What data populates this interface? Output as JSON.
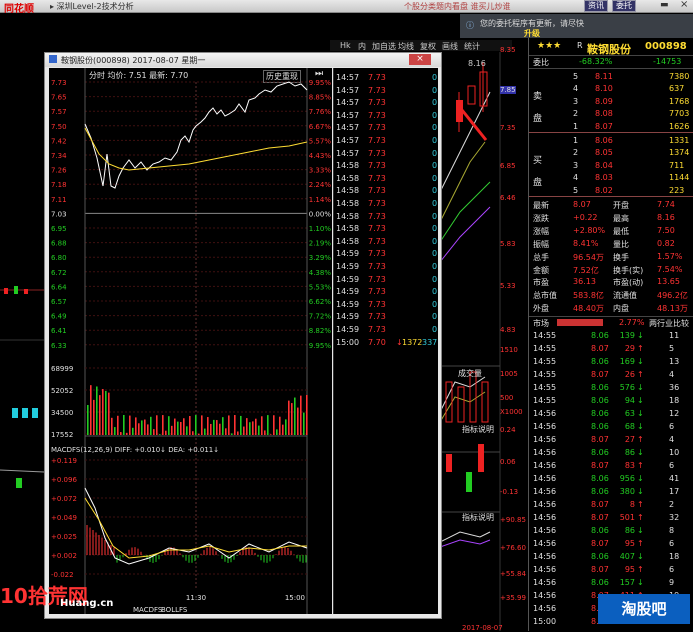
{
  "topbar": {
    "logo": "同花顺",
    "menu": "▸ 深圳Level-2技术分析",
    "ads": "个股分类题内看盘   谁买儿炒谁",
    "btn1": "资讯",
    "btn2": "委托"
  },
  "notify": {
    "line1": "您的委托程序有更新，请尽快",
    "line2": "升级"
  },
  "toolbar": {
    "items": [
      "Hk",
      "内",
      "加自选",
      "均线",
      "复权",
      "画线",
      "统计"
    ]
  },
  "stock": {
    "name": "鞍钢股份",
    "code": "000898",
    "stars": "★★★",
    "r": "R",
    "weibi_label": "委比",
    "weibi": "-68.32%",
    "weicha": "-14753",
    "sell_label": "卖盘",
    "buy_label": "买盘",
    "asks": [
      {
        "lvl": "5",
        "price": "8.11",
        "vol": "7380"
      },
      {
        "lvl": "4",
        "price": "8.10",
        "vol": "637"
      },
      {
        "lvl": "3",
        "price": "8.09",
        "vol": "1768"
      },
      {
        "lvl": "2",
        "price": "8.08",
        "vol": "7703"
      },
      {
        "lvl": "1",
        "price": "8.07",
        "vol": "1626"
      }
    ],
    "bids": [
      {
        "lvl": "1",
        "price": "8.06",
        "vol": "1331"
      },
      {
        "lvl": "2",
        "price": "8.05",
        "vol": "1374"
      },
      {
        "lvl": "3",
        "price": "8.04",
        "vol": "711"
      },
      {
        "lvl": "4",
        "price": "8.03",
        "vol": "1144"
      },
      {
        "lvl": "5",
        "price": "8.02",
        "vol": "223"
      }
    ],
    "stats": [
      {
        "l1": "最新",
        "v1": "8.07",
        "l2": "开盘",
        "v2": "7.74"
      },
      {
        "l1": "涨跌",
        "v1": "+0.22",
        "l2": "最高",
        "v2": "8.16"
      },
      {
        "l1": "涨幅",
        "v1": "+2.80%",
        "l2": "最低",
        "v2": "7.50"
      },
      {
        "l1": "振幅",
        "v1": "8.41%",
        "l2": "量比",
        "v2": "0.82"
      },
      {
        "l1": "总手",
        "v1": "96.54万",
        "l2": "换手",
        "v2": "1.57%"
      },
      {
        "l1": "金额",
        "v1": "7.52亿",
        "l2": "换手(实)",
        "v2": "7.54%"
      },
      {
        "l1": "市盈",
        "v1": "36.13",
        "l2": "市盈(动)",
        "v2": "13.65"
      },
      {
        "l1": "总市值",
        "v1": "583.8亿",
        "l2": "流通值",
        "v2": "496.2亿"
      },
      {
        "l1": "外盘",
        "v1": "48.40万",
        "l2": "内盘",
        "v2": "48.13万"
      }
    ],
    "bar_label": "市场",
    "bar_pct": "2.77%",
    "bar_right": "两行业比较",
    "trades": [
      {
        "t": "14:55",
        "p": "8.06",
        "v": "139",
        "d": "dn",
        "n": "11"
      },
      {
        "t": "14:55",
        "p": "8.07",
        "v": "29",
        "d": "up",
        "n": "5"
      },
      {
        "t": "14:55",
        "p": "8.06",
        "v": "169",
        "d": "dn",
        "n": "13"
      },
      {
        "t": "14:55",
        "p": "8.07",
        "v": "26",
        "d": "up",
        "n": "4"
      },
      {
        "t": "14:55",
        "p": "8.06",
        "v": "576",
        "d": "dn",
        "n": "36"
      },
      {
        "t": "14:55",
        "p": "8.06",
        "v": "94",
        "d": "dn",
        "n": "18"
      },
      {
        "t": "14:56",
        "p": "8.06",
        "v": "63",
        "d": "dn",
        "n": "12"
      },
      {
        "t": "14:56",
        "p": "8.06",
        "v": "68",
        "d": "dn",
        "n": "6"
      },
      {
        "t": "14:56",
        "p": "8.07",
        "v": "27",
        "d": "up",
        "n": "4"
      },
      {
        "t": "14:56",
        "p": "8.06",
        "v": "86",
        "d": "dn",
        "n": "10"
      },
      {
        "t": "14:56",
        "p": "8.07",
        "v": "83",
        "d": "up",
        "n": "6"
      },
      {
        "t": "14:56",
        "p": "8.06",
        "v": "956",
        "d": "dn",
        "n": "41"
      },
      {
        "t": "14:56",
        "p": "8.06",
        "v": "380",
        "d": "dn",
        "n": "17"
      },
      {
        "t": "14:56",
        "p": "8.07",
        "v": "8",
        "d": "up",
        "n": "2"
      },
      {
        "t": "14:56",
        "p": "8.07",
        "v": "501",
        "d": "up",
        "n": "32"
      },
      {
        "t": "14:56",
        "p": "8.06",
        "v": "86",
        "d": "dn",
        "n": "8"
      },
      {
        "t": "14:56",
        "p": "8.07",
        "v": "95",
        "d": "up",
        "n": "6"
      },
      {
        "t": "14:56",
        "p": "8.06",
        "v": "407",
        "d": "dn",
        "n": "18"
      },
      {
        "t": "14:56",
        "p": "8.07",
        "v": "95",
        "d": "up",
        "n": "6"
      },
      {
        "t": "14:56",
        "p": "8.06",
        "v": "157",
        "d": "dn",
        "n": "9"
      },
      {
        "t": "14:56",
        "p": "8.07",
        "v": "411",
        "d": "up",
        "n": "19"
      },
      {
        "t": "14:56",
        "p": "8.07",
        "v": "87",
        "d": "up",
        "n": "5"
      },
      {
        "t": "15:00",
        "p": "8.07",
        "v": "7769",
        "d": "up",
        "n": "9"
      }
    ]
  },
  "popup": {
    "title": "鞍钢股份(000898)  2017-08-07 星期一",
    "header": "分时  均价: 7.51  最新: 7.70",
    "history_btn": "历史重现",
    "price_labels": [
      "7.73",
      "7.65",
      "7.57",
      "7.50",
      "7.42",
      "7.34",
      "7.26",
      "7.18",
      "7.11",
      "7.03",
      "6.95",
      "6.88",
      "6.80",
      "6.72",
      "6.64",
      "6.57",
      "6.49",
      "6.41",
      "6.33"
    ],
    "pct_labels": [
      "9.95%",
      "8.85%",
      "7.76%",
      "6.67%",
      "5.57%",
      "4.43%",
      "3.33%",
      "2.24%",
      "1.14%",
      "0.00%",
      "1.10%",
      "2.19%",
      "3.29%",
      "4.38%",
      "5.53%",
      "6.62%",
      "7.72%",
      "8.82%",
      "9.95%"
    ],
    "vol_labels": [
      "68999",
      "52052",
      "34500",
      "17552"
    ],
    "macd_title": "MACDFS(12,26,9)  DIFF: +0.010↓  DEA: +0.011↓",
    "macd_labels": [
      "+0.119",
      "+0.096",
      "+0.072",
      "+0.049",
      "+0.025",
      "+0.002",
      "-0.022"
    ],
    "time_labels": [
      "11:30",
      "15:00"
    ],
    "tabs": [
      "MACDFS",
      "BOLLFS"
    ],
    "ticks": [
      {
        "t": "14:57",
        "p": "7.73",
        "v": "0"
      },
      {
        "t": "14:57",
        "p": "7.73",
        "v": "0"
      },
      {
        "t": "14:57",
        "p": "7.73",
        "v": "0"
      },
      {
        "t": "14:57",
        "p": "7.73",
        "v": "0"
      },
      {
        "t": "14:57",
        "p": "7.73",
        "v": "0"
      },
      {
        "t": "14:57",
        "p": "7.73",
        "v": "0"
      },
      {
        "t": "14:57",
        "p": "7.73",
        "v": "0"
      },
      {
        "t": "14:58",
        "p": "7.73",
        "v": "0"
      },
      {
        "t": "14:58",
        "p": "7.73",
        "v": "0"
      },
      {
        "t": "14:58",
        "p": "7.73",
        "v": "0"
      },
      {
        "t": "14:58",
        "p": "7.73",
        "v": "0"
      },
      {
        "t": "14:58",
        "p": "7.73",
        "v": "0"
      },
      {
        "t": "14:58",
        "p": "7.73",
        "v": "0"
      },
      {
        "t": "14:58",
        "p": "7.73",
        "v": "0"
      },
      {
        "t": "14:59",
        "p": "7.73",
        "v": "0"
      },
      {
        "t": "14:59",
        "p": "7.73",
        "v": "0"
      },
      {
        "t": "14:59",
        "p": "7.73",
        "v": "0"
      },
      {
        "t": "14:59",
        "p": "7.73",
        "v": "0"
      },
      {
        "t": "14:59",
        "p": "7.73",
        "v": "0"
      },
      {
        "t": "14:59",
        "p": "7.73",
        "v": "0"
      },
      {
        "t": "14:59",
        "p": "7.73",
        "v": "0"
      },
      {
        "t": "15:00",
        "p": "7.70",
        "v": "1372",
        "n": "337"
      }
    ]
  },
  "side_labels": {
    "vol": "成交量",
    "indicator1": "指标说明",
    "indicator2": "指标说明",
    "scale": "X1000",
    "right_prices": [
      "8.35",
      "7.85",
      "7.35",
      "6.85",
      "6.46",
      "5.83",
      "5.33",
      "4.83"
    ],
    "right_vols": [
      "1510",
      "1005",
      "500"
    ],
    "right_macd": [
      "0.24",
      "0.06",
      "-0.13"
    ],
    "right_kdj": [
      "+90.85",
      "+76.60",
      "+55.84",
      "+35.99"
    ],
    "k_labels": [
      "8.16",
      "7"
    ],
    "date_right": "2017-08-07"
  },
  "watermark": {
    "left": "10拾荒网",
    "left2": "Huang.cn",
    "right": "淘股吧"
  }
}
